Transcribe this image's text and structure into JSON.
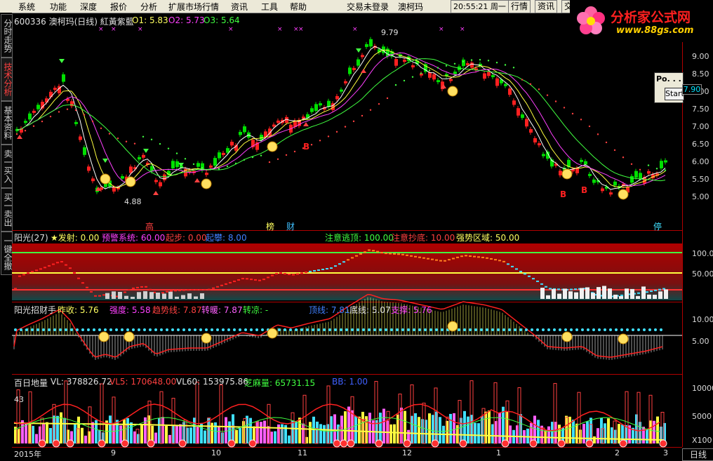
{
  "menu": {
    "items": [
      "系统",
      "功能",
      "深度",
      "报价",
      "分析",
      "扩展市场行情",
      "资讯",
      "工具",
      "帮助"
    ],
    "center_items": [
      "交易未登录",
      "澳柯玛"
    ],
    "clock": "20:55:21 周一",
    "buttons": [
      "行情",
      "资讯",
      "交"
    ]
  },
  "logo": {
    "text": "分析家公式网",
    "url_text": "www.88gs.com"
  },
  "left_tabs": [
    "分时走势",
    "技术分析",
    "基本资料",
    "卖一买入",
    "买一卖出",
    "一键全撤"
  ],
  "main_chart": {
    "stock_header": "600336 澳柯玛(日线) 紅黃紫藍",
    "o1": "O1: 5.83",
    "o2": "O2: 5.73",
    "o3": "O3: 5.64",
    "high_label": "9.79",
    "low_label": "4.88",
    "y_ticks": [
      "9.00",
      "8.50",
      "8.00",
      "7.50",
      "7.00",
      "6.50",
      "6.00",
      "5.50",
      "5.00"
    ],
    "markers": [
      "高",
      "榜",
      "财",
      "停"
    ],
    "b_label": "B",
    "current_price": "7.90",
    "popup_title": "Po. . .",
    "popup_button": "Start"
  },
  "panel2": {
    "title": "阳光(27)",
    "items": [
      {
        "text": "★发射: 0.00",
        "color": "#ffff60"
      },
      {
        "text": "预警系统: 60.00",
        "color": "#ff40ff"
      },
      {
        "text": "起步: 0.00",
        "color": "#ff4040"
      },
      {
        "text": "起攀: 8.00",
        "color": "#4080ff"
      },
      {
        "text": "注意逃顶: 100.00",
        "color": "#40ff40"
      },
      {
        "text": "注意抄底: 10.00",
        "color": "#ff4040"
      },
      {
        "text": "强势区域: 50.00",
        "color": "#ffff60"
      }
    ],
    "y_ticks": [
      "100.00",
      "50.00"
    ]
  },
  "panel3": {
    "title": "阳光招财手",
    "items": [
      {
        "text": "昨收: 5.76",
        "color": "#ffff60"
      },
      {
        "text": "强度: 5.58",
        "color": "#ff40ff"
      },
      {
        "text": "趋势线: 7.87",
        "color": "#ff4040"
      },
      {
        "text": "转暖: 7.87",
        "color": "#ff60ff"
      },
      {
        "text": "转凉: -",
        "color": "#40ff40"
      },
      {
        "text": "顶线: 7.81",
        "color": "#4080ff"
      },
      {
        "text": "底线: 5.07",
        "color": "#e0e0e0"
      },
      {
        "text": "支撑: 5.76",
        "color": "#ff40ff"
      }
    ],
    "y_ticks": [
      "10.00",
      "5.00"
    ]
  },
  "panel4": {
    "title": "百日地量",
    "items": [
      {
        "text": "VL: 378826.72",
        "color": "#e0e0e0"
      },
      {
        "text": "VL5: 170648.00",
        "color": "#ff4040"
      },
      {
        "text": "VL60: 153975.86",
        "color": "#e0e0e0"
      },
      {
        "text": "芝麻量: 65731.15",
        "color": "#40ff40"
      },
      {
        "text": "BB: 1.00",
        "color": "#4060ff"
      }
    ],
    "value_43": "43",
    "y_ticks": [
      "10000",
      "5000",
      "X100"
    ]
  },
  "x_axis": {
    "labels": [
      "2015年",
      "9",
      "10",
      "11",
      "12",
      "1",
      "2",
      "3"
    ]
  },
  "period_tab": "日线",
  "colors": {
    "up": "#ff2020",
    "down": "#00e000",
    "bg": "#000000",
    "grid": "#b00000"
  },
  "chart_data": {
    "type": "candlestick",
    "title": "600336 澳柯玛(日线)",
    "ylim": [
      4.7,
      9.9
    ],
    "high": 9.79,
    "low": 4.88
  }
}
